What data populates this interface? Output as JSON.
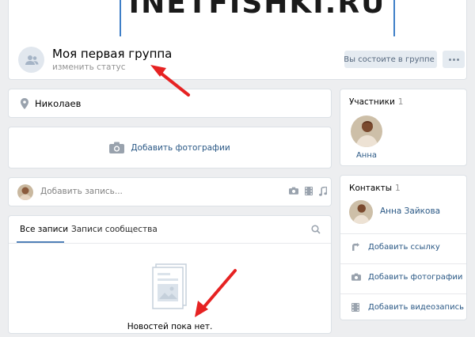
{
  "header": {
    "cover_text": "INETFISHKI.RU",
    "group_name": "Моя первая группа",
    "status_link": "изменить статус",
    "member_button": "Вы состоите в группе",
    "avatar_icon": "group-icon",
    "more_icon": "more-dots-icon"
  },
  "location": {
    "icon": "map-pin-icon",
    "city": "Николаев"
  },
  "add_photos": {
    "icon": "camera-icon",
    "label": "Добавить фотографии"
  },
  "post_box": {
    "placeholder": "Добавить запись...",
    "icons": [
      "camera-icon",
      "video-icon",
      "music-icon"
    ]
  },
  "feed": {
    "tabs": [
      {
        "label": "Все записи",
        "active": true
      },
      {
        "label": "Записи сообщества",
        "active": false
      }
    ],
    "search_icon": "search-icon",
    "empty_icon": "news-document-icon",
    "empty_text": "Новостей пока нет."
  },
  "members": {
    "title": "Участники",
    "count": "1",
    "people": [
      {
        "name": "Анна"
      }
    ]
  },
  "contacts": {
    "title": "Контакты",
    "count": "1",
    "person": "Анна Зайкова",
    "actions": [
      {
        "icon": "link-arrow-icon",
        "label": "Добавить ссылку"
      },
      {
        "icon": "camera-icon",
        "label": "Добавить фотографии"
      },
      {
        "icon": "film-icon",
        "label": "Добавить видеозапись"
      }
    ]
  },
  "colors": {
    "page_bg": "#edeef0",
    "link": "#2a5885",
    "accent": "#5181b8",
    "arrow": "#e62222",
    "button_bg": "#e5ebf1"
  }
}
